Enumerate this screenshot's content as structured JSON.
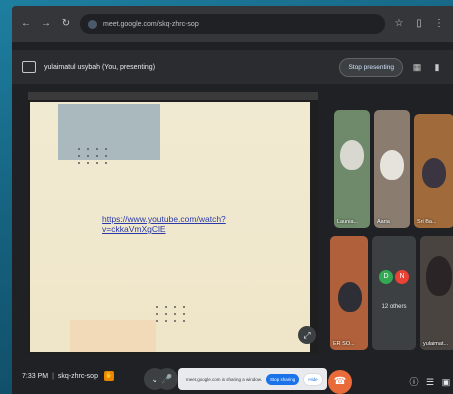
{
  "browser": {
    "url": "meet.google.com/skq-zhrc-sop",
    "icons": [
      "back-arrow-icon",
      "forward-arrow-icon",
      "reload-icon",
      "star-icon",
      "extension-icon",
      "menu-icon"
    ]
  },
  "presenting": {
    "label": "yulaimatul usybah (You, presenting)",
    "stop_label": "Stop presenting"
  },
  "slide": {
    "link_text": "https://www.youtube.com/watch?v=ckkaVmXgClE"
  },
  "participants": [
    {
      "name": "Launia..."
    },
    {
      "name": "Aaria"
    },
    {
      "name": "Sri Ba..."
    },
    {
      "name": "ER SO..."
    },
    {
      "name": "yulaimat..."
    }
  ],
  "others": {
    "label": "12 others",
    "avatars": [
      {
        "letter": "D",
        "color": "#34a853"
      },
      {
        "letter": "N",
        "color": "#ea4335"
      }
    ]
  },
  "meeting": {
    "time": "7:33 PM",
    "code": "skq-zhrc-sop"
  },
  "share_toast": {
    "text": "meet.google.com is sharing a window.",
    "stop_label": "Stop sharing",
    "hide_label": "Hide"
  },
  "colors": {
    "end_call": "#ea6b3a",
    "accent": "#1a73e8"
  }
}
